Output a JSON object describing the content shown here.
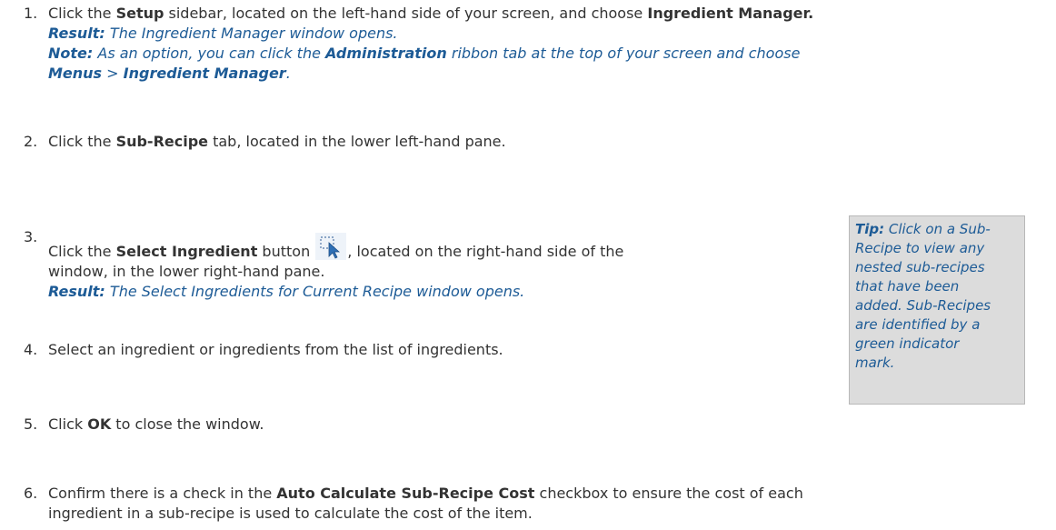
{
  "steps": [
    {
      "number": "1.",
      "lines": [
        {
          "kind": "normal",
          "segments": [
            {
              "t": "Click the ",
              "b": false
            },
            {
              "t": "Setup",
              "b": true
            },
            {
              "t": " sidebar, located on the left-hand side of your screen, and choose ",
              "b": false
            },
            {
              "t": "Ingredient Manager.",
              "b": true
            }
          ]
        },
        {
          "kind": "result",
          "segments": [
            {
              "t": "Result:",
              "b": true
            },
            {
              "t": " The Ingredient Manager window opens.",
              "b": false
            }
          ]
        },
        {
          "kind": "result",
          "segments": [
            {
              "t": "Note:",
              "b": true
            },
            {
              "t": " As an option, you can click the ",
              "b": false
            },
            {
              "t": "Administration",
              "b": true
            },
            {
              "t": " ribbon tab at the top of your screen and choose",
              "b": false
            }
          ]
        },
        {
          "kind": "result",
          "segments": [
            {
              "t": "Menus",
              "b": true
            },
            {
              "t": " > ",
              "b": false
            },
            {
              "t": "Ingredient Manager",
              "b": true
            },
            {
              "t": ".",
              "b": false
            }
          ]
        }
      ]
    },
    {
      "number": "2.",
      "lines": [
        {
          "kind": "normal",
          "segments": [
            {
              "t": "Click the ",
              "b": false
            },
            {
              "t": "Sub-Recipe",
              "b": true
            },
            {
              "t": " tab, located in the lower left-hand pane.",
              "b": false
            }
          ]
        }
      ]
    },
    {
      "number": "3.",
      "lines": [
        {
          "kind": "normal",
          "segments": [
            {
              "t": "Click the ",
              "b": false
            },
            {
              "t": "Select Ingredient",
              "b": true
            },
            {
              "t": " button ",
              "b": false
            },
            {
              "t": "",
              "b": false,
              "icon": "select-cursor-icon"
            },
            {
              "t": ", located on the right-hand side of the",
              "b": false
            }
          ]
        },
        {
          "kind": "normal",
          "segments": [
            {
              "t": "window, in the lower right-hand pane.",
              "b": false
            }
          ]
        },
        {
          "kind": "result",
          "segments": [
            {
              "t": "Result:",
              "b": true
            },
            {
              "t": " The Select Ingredients for Current Recipe window opens.",
              "b": false
            }
          ]
        }
      ]
    },
    {
      "number": "4.",
      "lines": [
        {
          "kind": "normal",
          "segments": [
            {
              "t": "Select an ingredient or ingredients from the list of ingredients.",
              "b": false
            }
          ]
        }
      ]
    },
    {
      "number": "5.",
      "lines": [
        {
          "kind": "normal",
          "segments": [
            {
              "t": "Click ",
              "b": false
            },
            {
              "t": "OK",
              "b": true
            },
            {
              "t": " to close the window.",
              "b": false
            }
          ]
        }
      ]
    },
    {
      "number": "6.",
      "lines": [
        {
          "kind": "normal",
          "segments": [
            {
              "t": "Confirm there is a check in the ",
              "b": false
            },
            {
              "t": "Auto Calculate Sub-Recipe Cost",
              "b": true
            },
            {
              "t": " checkbox to ensure the cost of each",
              "b": false
            }
          ]
        },
        {
          "kind": "normal",
          "segments": [
            {
              "t": "ingredient in a sub-recipe is used to calculate the cost of the item.",
              "b": false
            }
          ]
        }
      ]
    }
  ],
  "tip": {
    "lines": [
      [
        {
          "t": "Tip:",
          "b": true
        },
        {
          "t": " Click on a Sub-",
          "b": false
        }
      ],
      [
        {
          "t": "Recipe to view any",
          "b": false
        }
      ],
      [
        {
          "t": "nested sub-recipes",
          "b": false
        }
      ],
      [
        {
          "t": "that have been",
          "b": false
        }
      ],
      [
        {
          "t": "added. Sub-Recipes",
          "b": false
        }
      ],
      [
        {
          "t": "are identified by a",
          "b": false
        }
      ],
      [
        {
          "t": "green indicator",
          "b": false
        }
      ],
      [
        {
          "t": "mark.",
          "b": false
        }
      ]
    ]
  },
  "colors": {
    "text": "#333333",
    "result": "#1d5b96",
    "tip_bg": "#dcdcdc"
  }
}
